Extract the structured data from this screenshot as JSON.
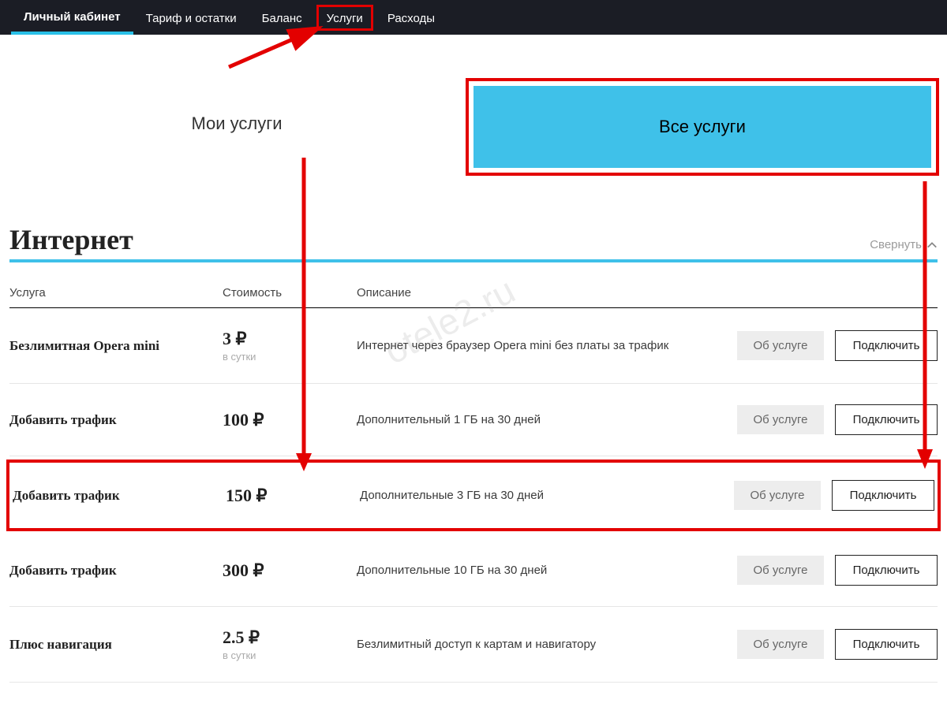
{
  "nav": {
    "items": [
      {
        "label": "Личный кабинет",
        "active": true
      },
      {
        "label": "Тариф и остатки"
      },
      {
        "label": "Баланс"
      },
      {
        "label": "Услуги",
        "boxed": true
      },
      {
        "label": "Расходы"
      }
    ]
  },
  "tabs": {
    "my": "Мои услуги",
    "all": "Все услуги"
  },
  "section": {
    "title": "Интернет",
    "collapse": "Свернуть"
  },
  "columns": {
    "service": "Услуга",
    "cost": "Стоимость",
    "desc": "Описание"
  },
  "buttons": {
    "about": "Об услуге",
    "connect": "Подключить"
  },
  "services": [
    {
      "name": "Безлимитная Opera mini",
      "price": "3 ₽",
      "period": "в сутки",
      "desc": "Интернет через браузер Opera mini без платы за трафик"
    },
    {
      "name": "Добавить трафик",
      "price": "100 ₽",
      "period": "",
      "desc": "Дополнительный 1 ГБ на 30 дней"
    },
    {
      "name": "Добавить трафик",
      "price": "150 ₽",
      "period": "",
      "desc": "Дополнительные 3 ГБ на 30 дней",
      "highlight": true
    },
    {
      "name": "Добавить трафик",
      "price": "300 ₽",
      "period": "",
      "desc": "Дополнительные 10 ГБ на 30 дней"
    },
    {
      "name": "Плюс навигация",
      "price": "2.5 ₽",
      "period": "в сутки",
      "desc": "Безлимитный доступ к картам и навигатору"
    }
  ],
  "watermark": "otele2.ru"
}
